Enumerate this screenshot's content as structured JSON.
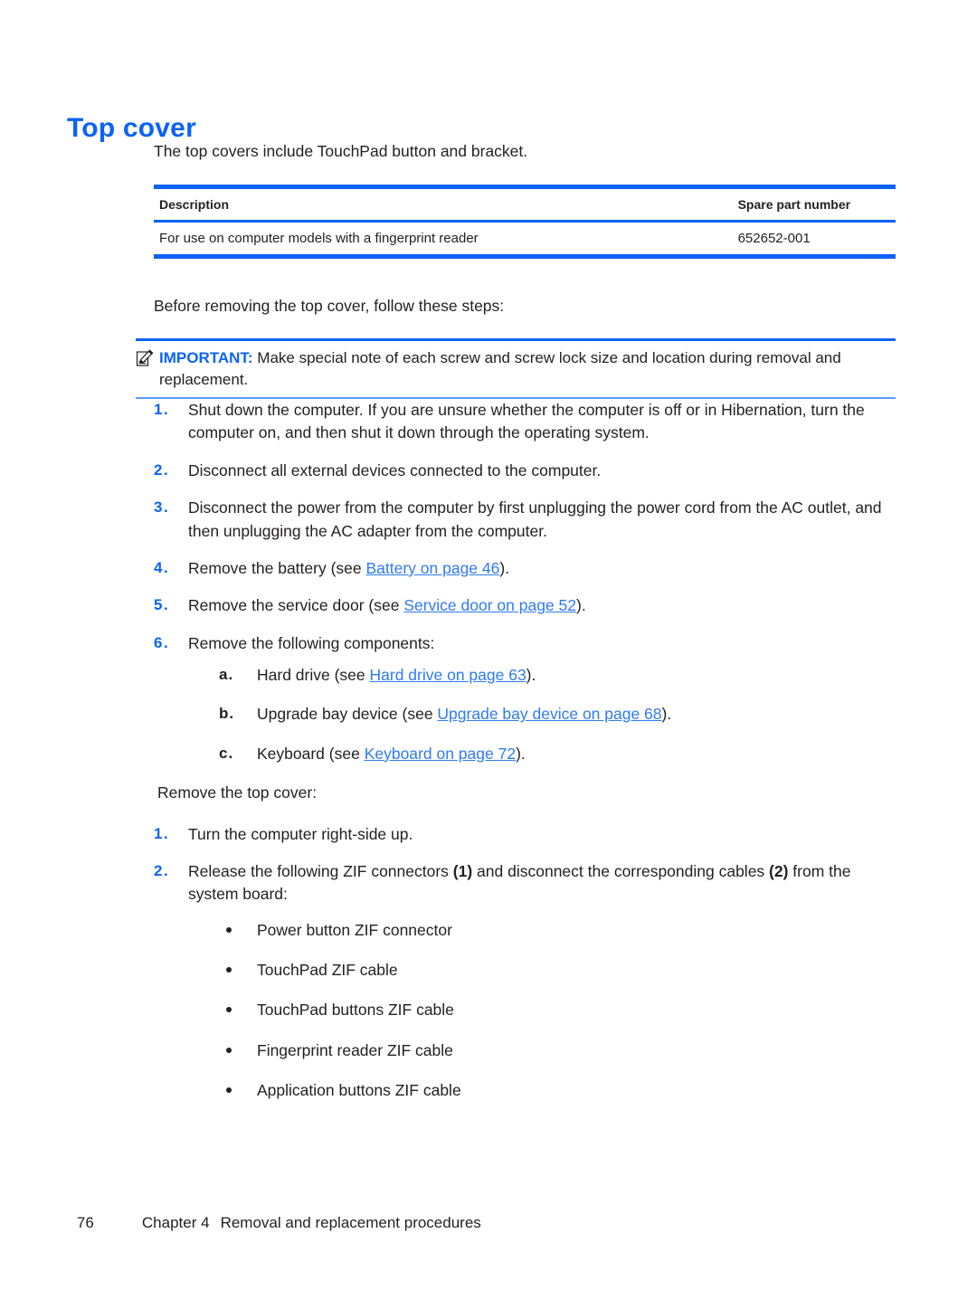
{
  "document": {
    "title": "Top cover",
    "intro": "The top covers include TouchPad button and bracket."
  },
  "table": {
    "headers": [
      "Description",
      "Spare part number"
    ],
    "rows": [
      [
        "For use on computer models with a fingerprint reader",
        "652652-001"
      ]
    ]
  },
  "before_steps_text": "Before removing the top cover, follow these steps:",
  "note": {
    "icon": "note-pencil-icon",
    "label": "IMPORTANT:",
    "text": "Make special note of each screw and screw lock size and location during removal and replacement."
  },
  "steps_before": {
    "items": [
      {
        "marker": "1.",
        "text": "Shut down the computer. If you are unsure whether the computer is off or in Hibernation, turn the computer on, and then shut it down through the operating system."
      },
      {
        "marker": "2.",
        "text": "Disconnect all external devices connected to the computer."
      },
      {
        "marker": "3.",
        "text": "Disconnect the power from the computer by first unplugging the power cord from the AC outlet, and then unplugging the AC adapter from the computer."
      },
      {
        "marker": "4.",
        "pre": "Remove the battery (see ",
        "link": "Battery on page 46",
        "post": ")."
      },
      {
        "marker": "5.",
        "pre": "Remove the service door (see ",
        "link": "Service door on page 52",
        "post": ")."
      },
      {
        "marker": "6.",
        "text": "Remove the following components:"
      }
    ],
    "substeps": [
      {
        "marker": "a.",
        "pre": "Hard drive (see ",
        "link": "Hard drive on page 63",
        "post": ")."
      },
      {
        "marker": "b.",
        "pre": "Upgrade bay device (see ",
        "link": "Upgrade bay device on page 68",
        "post": ")."
      },
      {
        "marker": "c.",
        "pre": "Keyboard (see ",
        "link": "Keyboard on page 72",
        "post": ")."
      }
    ]
  },
  "remove_lead": "Remove the top cover:",
  "steps_remove": {
    "items": [
      {
        "marker": "1.",
        "text": "Turn the computer right-side up."
      },
      {
        "marker": "2.",
        "seg1": "Release the following ZIF connectors ",
        "bold1": "(1)",
        "seg2": " and disconnect the corresponding cables ",
        "bold2": "(2)",
        "seg3": " from the system board:"
      }
    ],
    "bullets": [
      "Power button ZIF connector",
      "TouchPad ZIF cable",
      "TouchPad buttons ZIF cable",
      "Fingerprint reader ZIF cable",
      "Application buttons ZIF cable"
    ]
  },
  "footer": {
    "page_number": "76",
    "chapter": "Chapter 4",
    "chapter_title": "Removal and replacement procedures"
  },
  "colors": {
    "accent_blue": "#0b63f6",
    "link_blue": "#2f7bf0",
    "text": "#231f20"
  }
}
